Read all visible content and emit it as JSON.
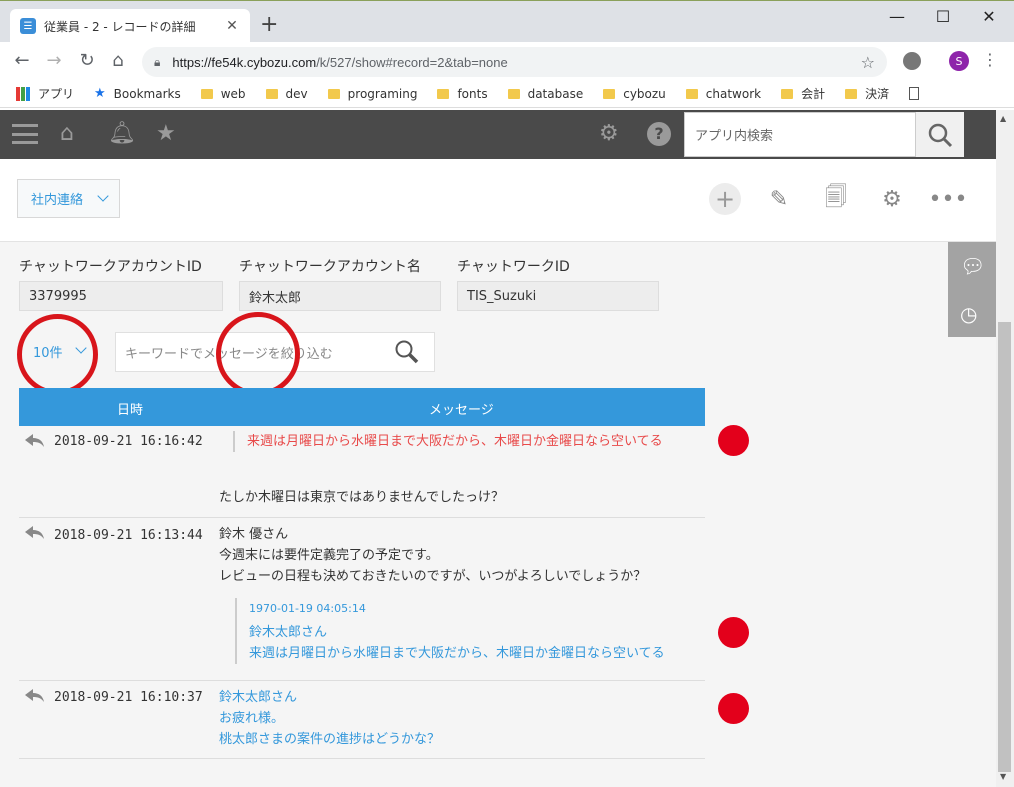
{
  "browser": {
    "tab_title": "従業員 - 2 - レコードの詳細",
    "new_tab": "+",
    "url_host": "https://fe54k.cybozu.com",
    "url_path": "/k/527/show#record=2&tab=none",
    "avatar_letter": "S",
    "bookmarks": [
      "アプリ",
      "Bookmarks",
      "web",
      "dev",
      "programing",
      "fonts",
      "database",
      "cybozu",
      "chatwork",
      "会計",
      "決済"
    ]
  },
  "header": {
    "search_placeholder": "アプリ内検索"
  },
  "record_toolbar": {
    "view_label": "社内連絡"
  },
  "fields": [
    {
      "label": "チャットワークアカウントID",
      "value": "3379995"
    },
    {
      "label": "チャットワークアカウント名",
      "value": "鈴木太郎"
    },
    {
      "label": "チャットワークID",
      "value": "TIS_Suzuki"
    }
  ],
  "filter": {
    "count_label": "10件",
    "placeholder": "キーワードでメッセージを絞り込む"
  },
  "table": {
    "col_datetime": "日時",
    "col_message": "メッセージ",
    "rows": [
      {
        "datetime": "2018-09-21 16:16:42",
        "quote": "来週は月曜日から水曜日まで大阪だから、木曜日か金曜日なら空いてる",
        "text": "たしか木曜日は東京ではありませんでしたっけ？"
      },
      {
        "datetime": "2018-09-21 16:13:44",
        "line1": "鈴木 優さん",
        "line2": "今週末には要件定義完了の予定です。",
        "line3": "レビューの日程も決めておきたいのですが、いつがよろしいでしょうか？",
        "quote_time": "1970-01-19 04:05:14",
        "quote_name": "鈴木太郎さん",
        "quote_text": "来週は月曜日から水曜日まで大阪だから、木曜日か金曜日なら空いてる"
      },
      {
        "datetime": "2018-09-21 16:10:37",
        "line1": "鈴木太郎さん",
        "line2": "お疲れ様。",
        "line3": "桃太郎さまの案件の進捗はどうかな？"
      }
    ]
  },
  "colors": {
    "header_bg": "#4a4a4a",
    "table_header": "#3498db",
    "annotation_red": "#d8151b",
    "dot_red": "#e3001b"
  }
}
